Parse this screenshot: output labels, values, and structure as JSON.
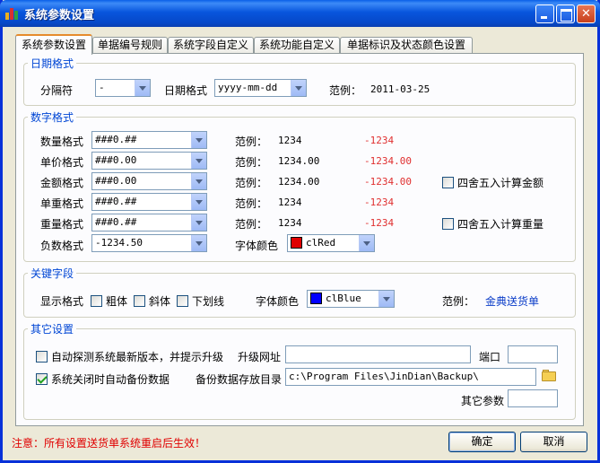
{
  "window": {
    "title": "系统参数设置"
  },
  "tabs": [
    "系统参数设置",
    "单据编号规则",
    "系统字段自定义",
    "系统功能自定义",
    "单据标识及状态颜色设置"
  ],
  "date_group": {
    "legend": "日期格式",
    "separator_label": "分隔符",
    "separator_value": "-",
    "format_label": "日期格式",
    "format_value": "yyyy-mm-dd",
    "sample_label": "范例：",
    "sample_value": "2011-03-25"
  },
  "number_group": {
    "legend": "数字格式",
    "rows": [
      {
        "label": "数量格式",
        "format": "###0.##",
        "sample_label": "范例：",
        "positive": "1234",
        "negative": "-1234"
      },
      {
        "label": "单价格式",
        "format": "###0.00",
        "sample_label": "范例：",
        "positive": "1234.00",
        "negative": "-1234.00"
      },
      {
        "label": "金额格式",
        "format": "###0.00",
        "sample_label": "范例：",
        "positive": "1234.00",
        "negative": "-1234.00"
      },
      {
        "label": "单重格式",
        "format": "###0.##",
        "sample_label": "范例：",
        "positive": "1234",
        "negative": "-1234"
      },
      {
        "label": "重量格式",
        "format": "###0.##",
        "sample_label": "范例：",
        "positive": "1234",
        "negative": "-1234"
      }
    ],
    "round_amount": "四舍五入计算金额",
    "round_weight": "四舍五入计算重量",
    "negative_label": "负数格式",
    "negative_value": "-1234.50",
    "font_color_label": "字体颜色",
    "font_color_value": "clRed",
    "font_color_hex": "#e00000"
  },
  "key_group": {
    "legend": "关键字段",
    "display_label": "显示格式",
    "bold": "粗体",
    "italic": "斜体",
    "underline": "下划线",
    "font_color_label": "字体颜色",
    "font_color_value": "clBlue",
    "font_color_hex": "#0000ff",
    "sample_label": "范例：",
    "sample_value": "金典送货单"
  },
  "other_group": {
    "legend": "其它设置",
    "auto_detect": "自动探测系统最新版本，并提示升级",
    "upgrade_url_label": "升级网址",
    "upgrade_url_value": "",
    "port_label": "端口",
    "port_value": "",
    "auto_backup": "系统关闭时自动备份数据",
    "backup_dir_label": "备份数据存放目录",
    "backup_dir_value": "c:\\Program Files\\JinDian\\Backup\\",
    "other_params_label": "其它参数",
    "other_params_value": ""
  },
  "footer": {
    "notice": "注意：所有设置送货单系统重启后生效！",
    "ok": "确定",
    "cancel": "取消"
  },
  "colors": {
    "title_blue": "#0855dd",
    "group_legend": "#0046d5",
    "negative_red": "#e03030"
  }
}
